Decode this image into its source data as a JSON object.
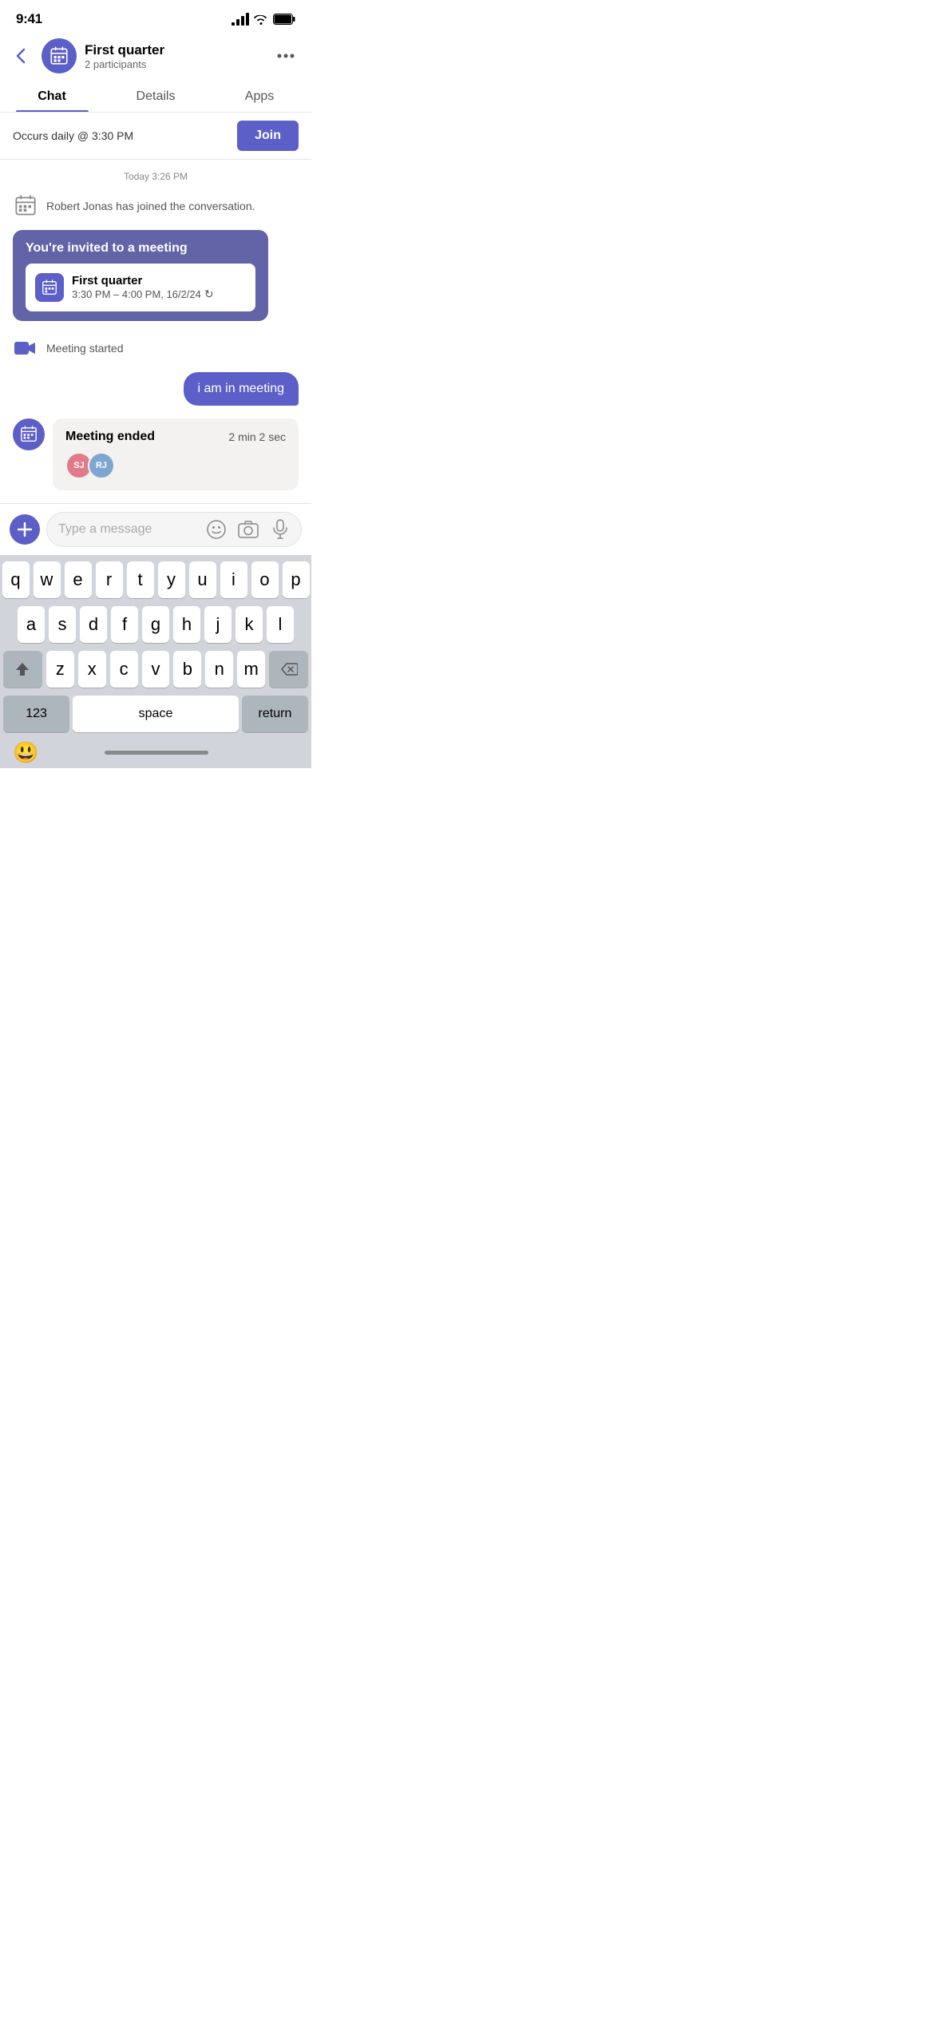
{
  "statusBar": {
    "time": "9:41",
    "signalBars": [
      4,
      8,
      12,
      16
    ],
    "batteryLevel": "100"
  },
  "header": {
    "backLabel": "‹",
    "title": "First quarter",
    "subtitle": "2 participants",
    "moreLabel": "•••"
  },
  "tabs": [
    {
      "id": "chat",
      "label": "Chat",
      "active": true
    },
    {
      "id": "details",
      "label": "Details",
      "active": false
    },
    {
      "id": "apps",
      "label": "Apps",
      "active": false
    }
  ],
  "joinBanner": {
    "text": "Occurs daily @ 3:30 PM",
    "buttonLabel": "Join"
  },
  "chat": {
    "timestamp": "Today  3:26 PM",
    "systemJoin": "Robert Jonas has joined the conversation.",
    "inviteCard": {
      "title": "You're invited to a meeting",
      "meetingTitle": "First quarter",
      "meetingTime": "3:30 PM – 4:00 PM, 16/2/24"
    },
    "meetingStarted": "Meeting started",
    "outgoingMessage": "i am in meeting",
    "meetingEndedTitle": "Meeting ended",
    "meetingDuration": "2 min 2 sec",
    "participants": [
      {
        "initials": "SJ",
        "colorClass": "pa-sj"
      },
      {
        "initials": "RJ",
        "colorClass": "pa-rj"
      }
    ]
  },
  "messageInput": {
    "placeholder": "Type a message",
    "plusLabel": "+",
    "emojiLabel": "☺",
    "cameraLabel": "⊡",
    "micLabel": "⏺"
  },
  "keyboard": {
    "rows": [
      [
        "q",
        "w",
        "e",
        "r",
        "t",
        "y",
        "u",
        "i",
        "o",
        "p"
      ],
      [
        "a",
        "s",
        "d",
        "f",
        "g",
        "h",
        "j",
        "k",
        "l"
      ],
      [
        "z",
        "x",
        "c",
        "v",
        "b",
        "n",
        "m"
      ]
    ],
    "bottomRow": {
      "num": "123",
      "space": "space",
      "return": "return"
    },
    "emojiFace": "😃"
  }
}
